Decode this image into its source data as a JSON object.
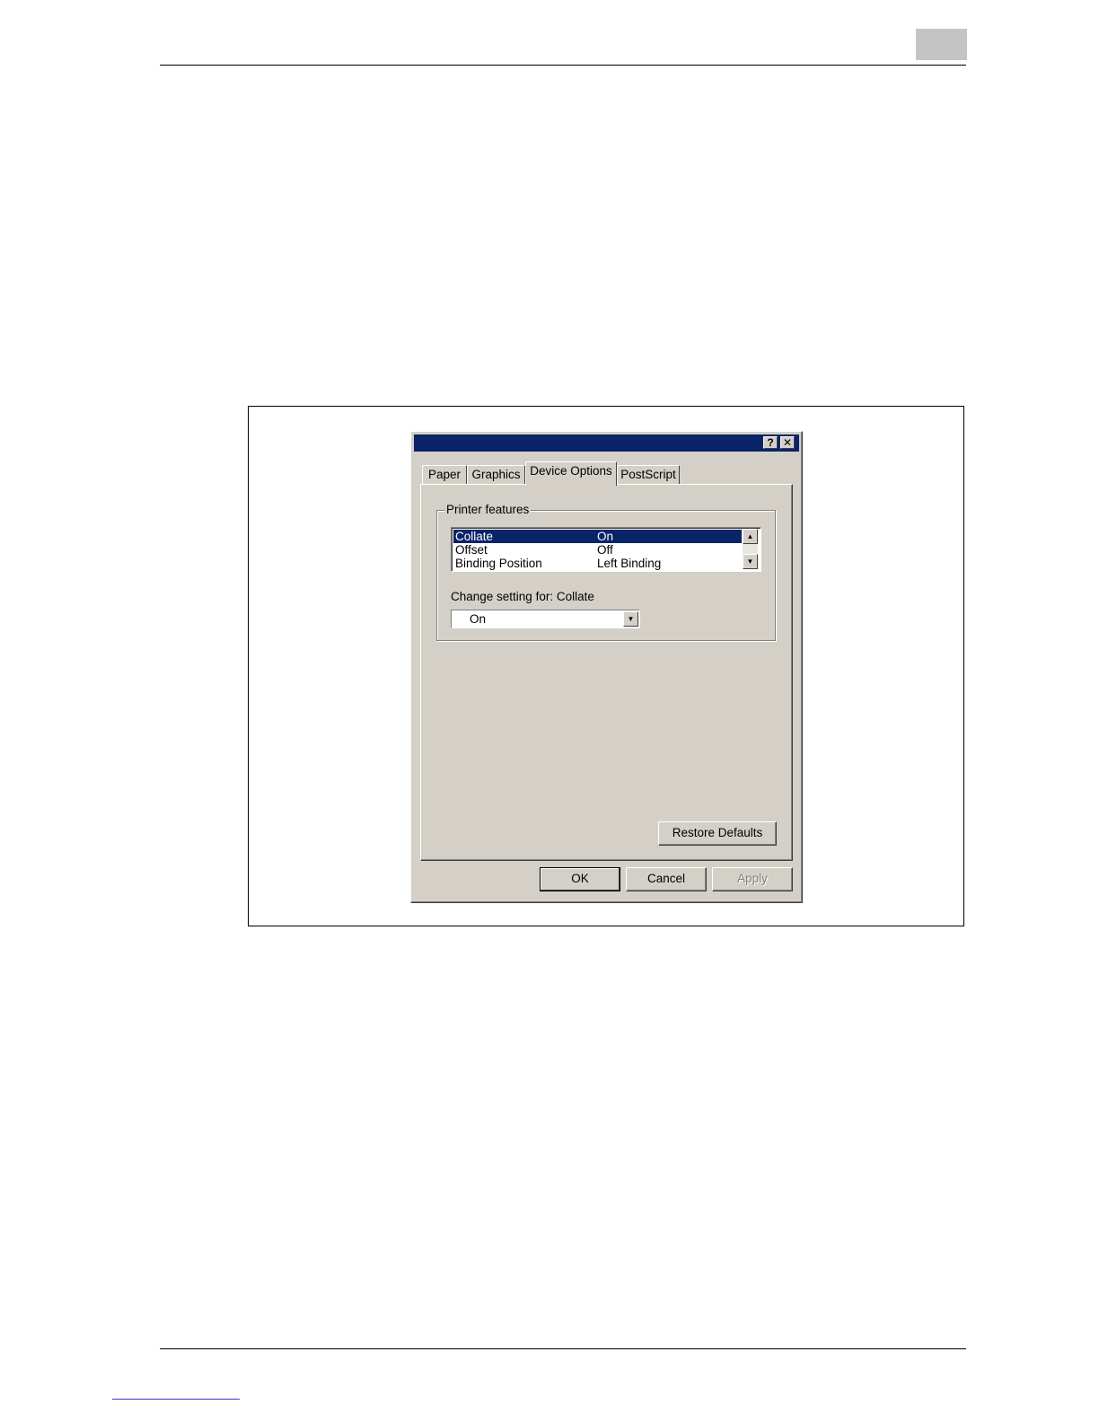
{
  "dialog": {
    "icons": {
      "help": "question-mark-icon",
      "close": "close-x-icon"
    },
    "help_glyph": "?",
    "close_glyph": "✕",
    "tabs": [
      {
        "label": "Paper",
        "active": false
      },
      {
        "label": "Graphics",
        "active": false
      },
      {
        "label": "Device Options",
        "active": true
      },
      {
        "label": "PostScript",
        "active": false
      }
    ],
    "group": {
      "legend": "Printer features",
      "features": [
        {
          "name": "Collate",
          "value": "On",
          "selected": true
        },
        {
          "name": "Offset",
          "value": "Off",
          "selected": false
        },
        {
          "name": "Binding Position",
          "value": "Left Binding",
          "selected": false
        }
      ],
      "scroll_up_glyph": "▲",
      "scroll_down_glyph": "▼",
      "change_label": "Change setting for:  Collate",
      "combo_value": "On",
      "combo_glyph": "▼"
    },
    "buttons": {
      "restore_defaults": "Restore Defaults",
      "ok": "OK",
      "cancel": "Cancel",
      "apply": "Apply"
    },
    "colors": {
      "titlebar": "#0a246a",
      "face": "#d4d0c8",
      "selection": "#0a246a"
    }
  }
}
